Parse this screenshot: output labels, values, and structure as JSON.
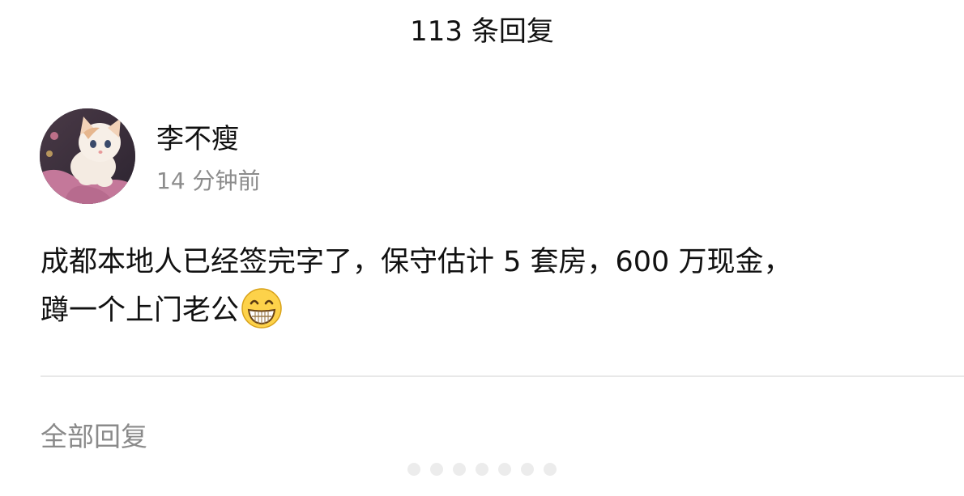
{
  "header": {
    "title": "113 条回复"
  },
  "post": {
    "author": "李不瘦",
    "time": "14 分钟前",
    "lines": [
      "成都本地人已经签完字了，保守估计 5 套房，600 万现金，",
      "蹲一个上门老公"
    ],
    "emoji": "grinning-face-icon"
  },
  "replies": {
    "section_title": "全部回复"
  }
}
